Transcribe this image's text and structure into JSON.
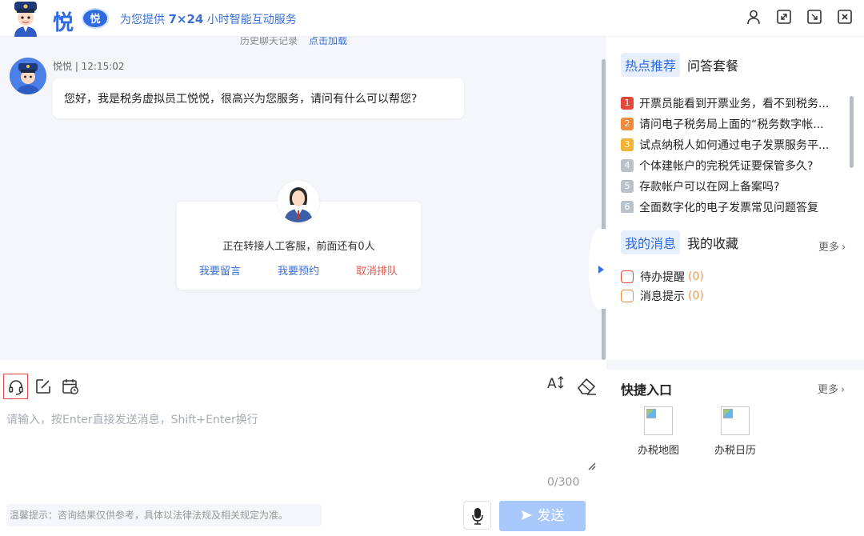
{
  "header": {
    "logo_text": "悦",
    "logo_badge": "悦",
    "slogan_prefix": "为您提供 ",
    "slogan_strong": "7×24",
    "slogan_suffix": " 小时智能互动服务",
    "icons": [
      "user-icon",
      "expand-icon",
      "minimize-icon",
      "close-icon"
    ]
  },
  "chat": {
    "history_label": "历史聊天记录",
    "history_link": "点击加载",
    "message": {
      "meta": "悦悦 | 12:15:02",
      "text": "您好，我是税务虚拟员工悦悦，很高兴为您服务，请问有什么可以帮您?"
    },
    "transfer": {
      "status": "正在转接人工客服，前面还有0人",
      "leave_message": "我要留言",
      "appointment": "我要预约",
      "cancel_queue": "取消排队"
    }
  },
  "input": {
    "placeholder": "请输入，按Enter直接发送消息，Shift+Enter换行",
    "value": "",
    "font_tool": "A",
    "counter": "0/300",
    "tip": "温馨提示：咨询结果仅供参考，具体以法律法规及相关规定为准。",
    "send_label": "发送",
    "tools": [
      "headset-icon",
      "edit-icon",
      "calendar-icon",
      "font-size-icon",
      "eraser-icon"
    ]
  },
  "right": {
    "hot_tabs": [
      "热点推荐",
      "问答套餐"
    ],
    "hot_items": [
      {
        "num": "1",
        "text": "开票员能看到开票业务，看不到税务...",
        "color": "#e5483a"
      },
      {
        "num": "2",
        "text": "请问电子税务局上面的“税务数字帐...",
        "color": "#f08a3c"
      },
      {
        "num": "3",
        "text": "试点纳税人如何通过电子发票服务平...",
        "color": "#f2b233"
      },
      {
        "num": "4",
        "text": "个体建帐户的完税凭证要保管多久?",
        "color": "#b9c1cc"
      },
      {
        "num": "5",
        "text": "存款帐户可以在网上备案吗?",
        "color": "#b9c1cc"
      },
      {
        "num": "6",
        "text": "全面数字化的电子发票常见问题答复",
        "color": "#b9c1cc"
      }
    ],
    "msg_tabs": [
      "我的消息",
      "我的收藏"
    ],
    "msg_more": "更多",
    "msg_items": [
      {
        "label": "待办提醒",
        "count": "(0)",
        "color": "#e5483a"
      },
      {
        "label": "消息提示",
        "count": "(0)",
        "color": "#f08a3c"
      }
    ],
    "quick_title": "快捷入口",
    "quick_more": "更多",
    "quick_items": [
      {
        "label": "办税地图"
      },
      {
        "label": "办税日历"
      }
    ]
  }
}
